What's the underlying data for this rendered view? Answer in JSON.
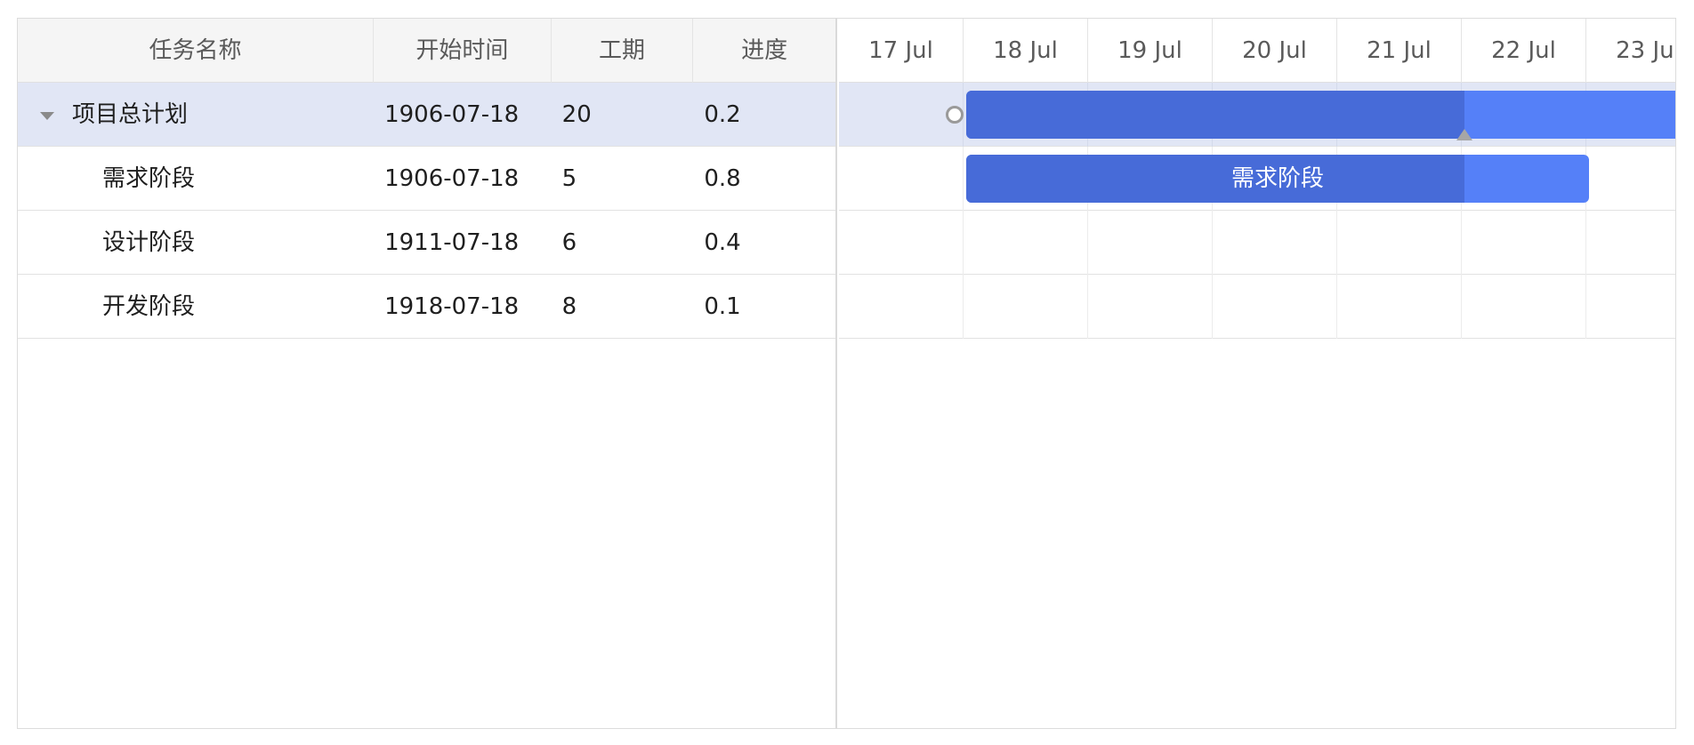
{
  "columns": [
    {
      "key": "name",
      "label": "任务名称"
    },
    {
      "key": "start",
      "label": "开始时间"
    },
    {
      "key": "duration",
      "label": "工期"
    },
    {
      "key": "progress",
      "label": "进度"
    }
  ],
  "tasks": [
    {
      "name": "项目总计划",
      "start": "1906-07-18",
      "duration": "20",
      "progress": "0.2",
      "expanded": true,
      "selected": true,
      "progress_value": 0.2
    },
    {
      "name": "需求阶段",
      "start": "1906-07-18",
      "duration": "5",
      "progress": "0.8",
      "bar_label": "需求阶段",
      "progress_value": 0.8
    },
    {
      "name": "设计阶段",
      "start": "1911-07-18",
      "duration": "6",
      "progress": "0.4"
    },
    {
      "name": "开发阶段",
      "start": "1918-07-18",
      "duration": "8",
      "progress": "0.1"
    }
  ],
  "timescale": [
    "17 Jul",
    "18 Jul",
    "19 Jul",
    "20 Jul",
    "21 Jul",
    "22 Jul",
    "23 Jul"
  ],
  "colors": {
    "bar": "#5580f8",
    "bar_progress": "#476bd8",
    "selected_row": "#e1e6f5",
    "header_bg": "#f5f5f5"
  },
  "icons": {
    "toggle": "caret-down-icon",
    "link": "link-circle-icon",
    "progress_handle": "triangle-up-icon"
  }
}
